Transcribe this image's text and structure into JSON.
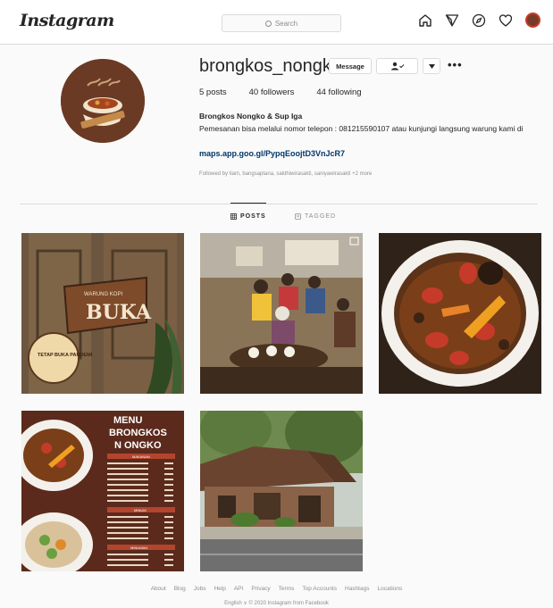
{
  "nav": {
    "logo": "Instagram",
    "search_placeholder": "Search",
    "icons": [
      "home-icon",
      "direct-icon",
      "explore-icon",
      "activity-icon",
      "profile-avatar"
    ]
  },
  "profile": {
    "username": "brongkos_nongko",
    "message_label": "Message",
    "stats": {
      "posts": "5 posts",
      "followers": "40 followers",
      "following": "44 following"
    },
    "full_name": "Brongkos Nongko & Sup Iga",
    "bio": "Pemesanan bisa melalui nomor telepon : 081215590107 atau kunjungi langsung warung kami di",
    "link": "maps.app.goo.gl/PypqEoojtD3VnJcR7",
    "followed_by": "Followed by tiam, bangsaptana, sakthiwirasakti, saniyawirasakti +2 more"
  },
  "tabs": {
    "posts": "POSTS",
    "tagged": "TAGGED"
  },
  "posts": {
    "p1_sign": "BUKA",
    "p1_sign_top": "WARUNG KOPI",
    "p1_badge": "TETAP BUKA PANDEMI",
    "p4_title": "MENU BRONGKOS NONGKO",
    "p4_sections": [
      "MAKANAN",
      "MINUM",
      "MINUMAN"
    ]
  },
  "footer": {
    "links": [
      "About",
      "Blog",
      "Jobs",
      "Help",
      "API",
      "Privacy",
      "Terms",
      "Top Accounts",
      "Hashtags",
      "Locations"
    ],
    "copyright": "English ∨    © 2020 Instagram from Facebook"
  },
  "colors": {
    "background": "#fafafa",
    "link": "#00376b",
    "muted": "#8e8e8e"
  }
}
